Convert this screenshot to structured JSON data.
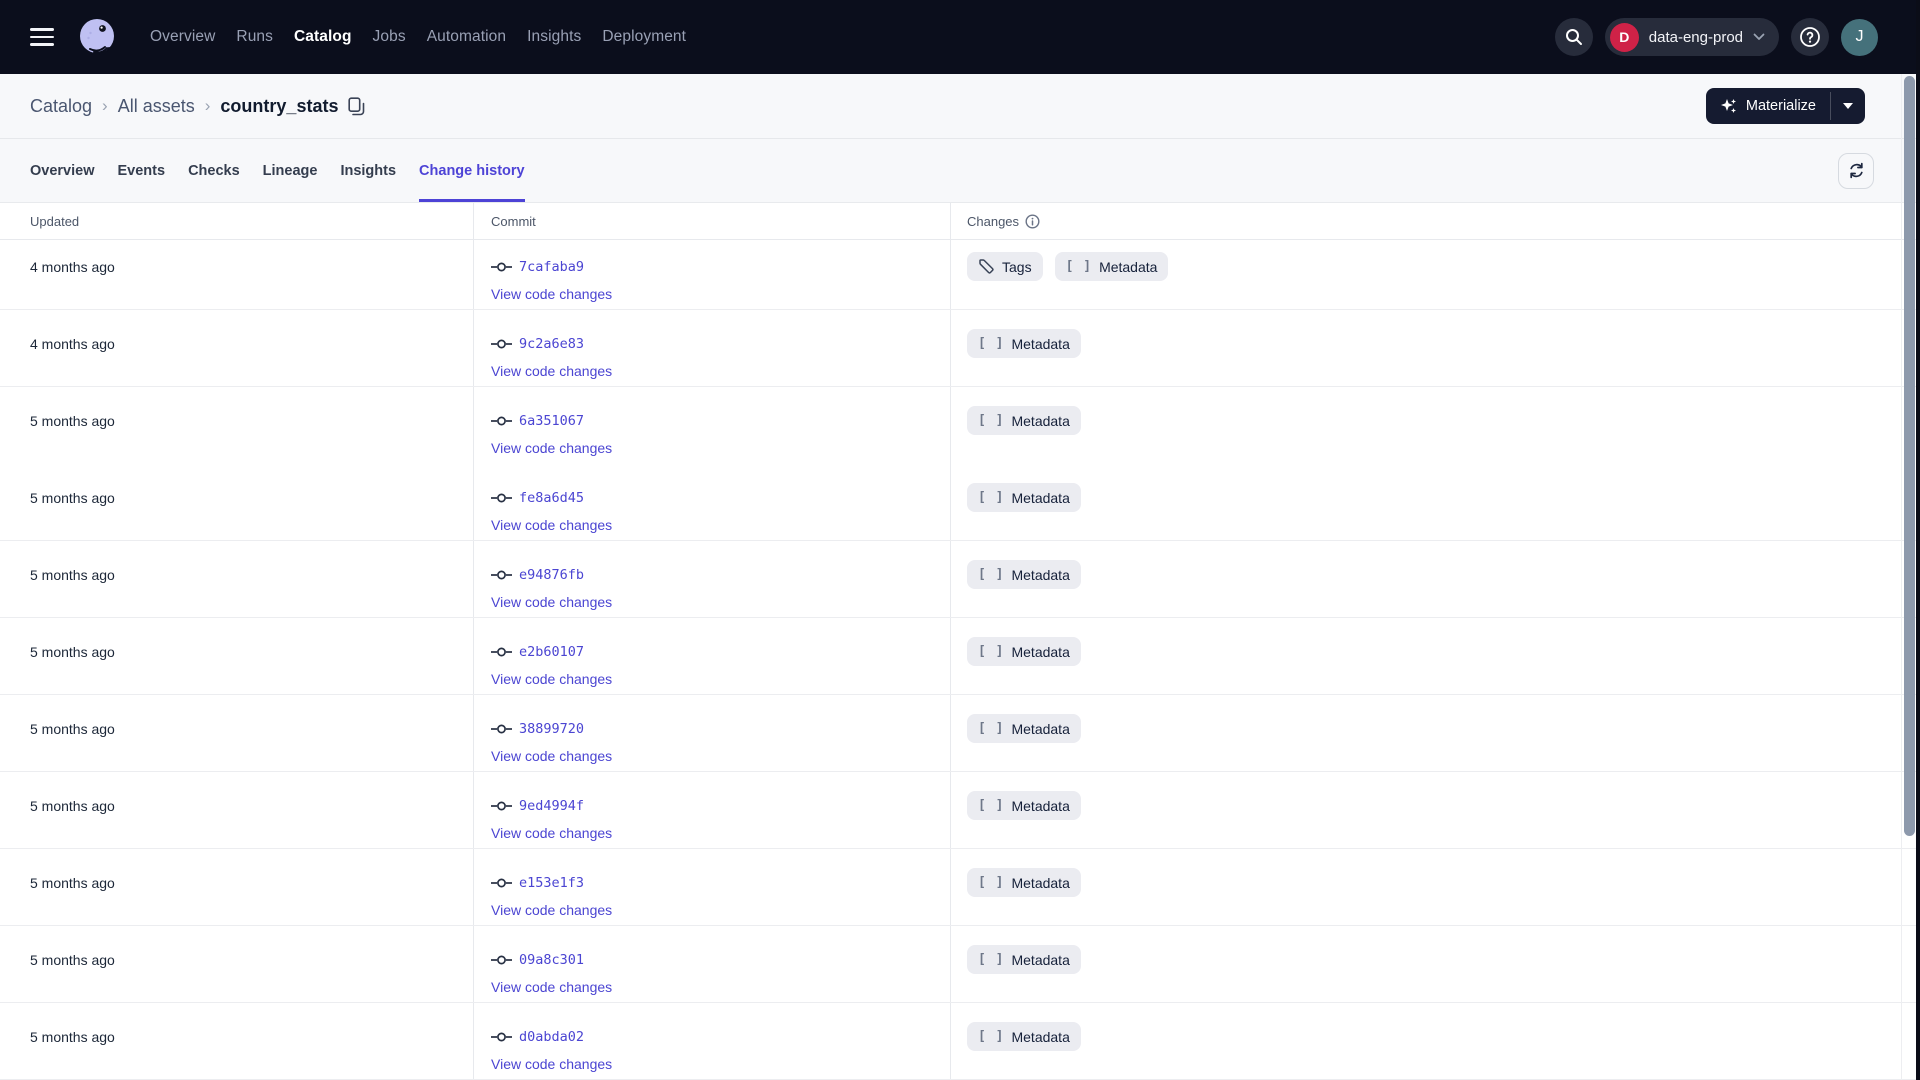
{
  "colors": {
    "accent": "#4D43D6",
    "accent_link": "#4B45D2",
    "nav_bg": "#0B0E1C",
    "badge_red": "#CF2247",
    "avatar_teal": "#45717B"
  },
  "nav": {
    "items": [
      {
        "label": "Overview",
        "active": false
      },
      {
        "label": "Runs",
        "active": false
      },
      {
        "label": "Catalog",
        "active": true
      },
      {
        "label": "Jobs",
        "active": false
      },
      {
        "label": "Automation",
        "active": false
      },
      {
        "label": "Insights",
        "active": false
      },
      {
        "label": "Deployment",
        "active": false
      }
    ],
    "deployment": {
      "initial": "D",
      "name": "data-eng-prod"
    },
    "avatar_initial": "J"
  },
  "breadcrumb": {
    "links": [
      "Catalog",
      "All assets"
    ],
    "current": "country_stats",
    "separator": "›"
  },
  "actions": {
    "materialize_label": "Materialize"
  },
  "tabs": {
    "items": [
      {
        "label": "Overview",
        "active": false
      },
      {
        "label": "Events",
        "active": false
      },
      {
        "label": "Checks",
        "active": false
      },
      {
        "label": "Lineage",
        "active": false
      },
      {
        "label": "Insights",
        "active": false
      },
      {
        "label": "Change history",
        "active": true
      }
    ]
  },
  "table": {
    "columns": [
      "Updated",
      "Commit",
      "Changes"
    ],
    "metadata_brackets_glyph": "[ ]",
    "rows": [
      {
        "updated": "4 months ago",
        "commit": "7cafaba9",
        "link": "View code changes",
        "changes": [
          "Tags",
          "Metadata"
        ]
      },
      {
        "updated": "4 months ago",
        "commit": "9c2a6e83",
        "link": "View code changes",
        "changes": [
          "Metadata"
        ]
      },
      {
        "updated": "5 months ago",
        "commit": "6a351067",
        "link": "View code changes",
        "changes": [
          "Metadata"
        ]
      },
      {
        "updated": "5 months ago",
        "commit": "fe8a6d45",
        "link": "View code changes",
        "changes": [
          "Metadata"
        ]
      },
      {
        "updated": "5 months ago",
        "commit": "e94876fb",
        "link": "View code changes",
        "changes": [
          "Metadata"
        ]
      },
      {
        "updated": "5 months ago",
        "commit": "e2b60107",
        "link": "View code changes",
        "changes": [
          "Metadata"
        ]
      },
      {
        "updated": "5 months ago",
        "commit": "38899720",
        "link": "View code changes",
        "changes": [
          "Metadata"
        ]
      },
      {
        "updated": "5 months ago",
        "commit": "9ed4994f",
        "link": "View code changes",
        "changes": [
          "Metadata"
        ]
      },
      {
        "updated": "5 months ago",
        "commit": "e153e1f3",
        "link": "View code changes",
        "changes": [
          "Metadata"
        ]
      },
      {
        "updated": "5 months ago",
        "commit": "09a8c301",
        "link": "View code changes",
        "changes": [
          "Metadata"
        ]
      },
      {
        "updated": "5 months ago",
        "commit": "d0abda02",
        "link": "View code changes",
        "changes": [
          "Metadata"
        ]
      }
    ]
  }
}
